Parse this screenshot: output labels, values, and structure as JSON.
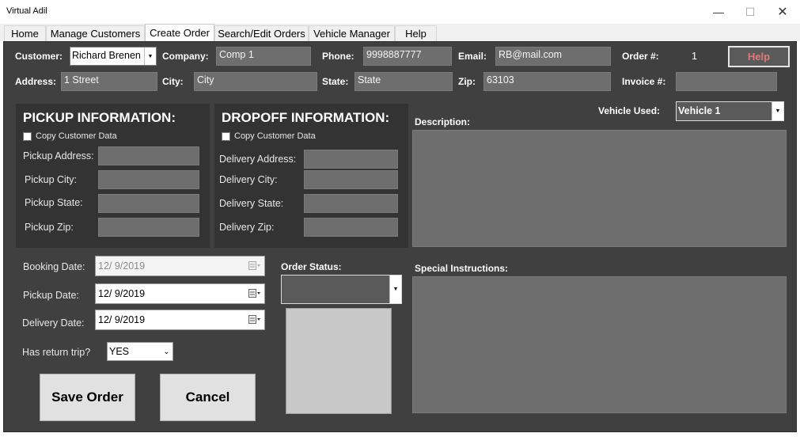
{
  "window": {
    "title": "Virtual Adil",
    "minimize": "—",
    "maximize": "☐",
    "close": "✕"
  },
  "tabs": [
    "Home",
    "Manage Customers",
    "Create Order",
    "Search/Edit Orders",
    "Vehicle Manager",
    "Help"
  ],
  "active_tab": "Create Order",
  "header": {
    "customer_label": "Customer:",
    "customer_value": "Richard Brenen",
    "company_label": "Company:",
    "company_value": "Comp 1",
    "phone_label": "Phone:",
    "phone_value": "9998887777",
    "email_label": "Email:",
    "email_value": "RB@mail.com",
    "order_label": "Order #:",
    "order_value": "1",
    "help_label": "Help",
    "address_label": "Address:",
    "address_value": "1 Street",
    "city_label": "City:",
    "city_value": "City",
    "state_label": "State:",
    "state_value": "State",
    "zip_label": "Zip:",
    "zip_value": "63103",
    "invoice_label": "Invoice #:",
    "invoice_value": ""
  },
  "pickup": {
    "heading": "PICKUP INFORMATION:",
    "copy_label": "Copy Customer Data",
    "address_label": "Pickup Address:",
    "city_label": "Pickup City:",
    "state_label": "Pickup State:",
    "zip_label": "Pickup Zip:"
  },
  "dropoff": {
    "heading": "DROPOFF INFORMATION:",
    "copy_label": "Copy Customer Data",
    "address_label": "Delivery Address:",
    "city_label": "Delivery City:",
    "state_label": "Delivery State:",
    "zip_label": "Delivery Zip:"
  },
  "vehicle": {
    "label": "Vehicle Used:",
    "value": "Vehicle 1"
  },
  "description_label": "Description:",
  "special_label": "Special Instructions:",
  "dates": {
    "booking_label": "Booking Date:",
    "booking_value": "12/  9/2019",
    "pickup_label": "Pickup Date:",
    "pickup_value": "12/  9/2019",
    "delivery_label": "Delivery Date:",
    "delivery_value": "12/  9/2019"
  },
  "return_trip": {
    "label": "Has return trip?",
    "value": "YES"
  },
  "order_status_label": "Order Status:",
  "buttons": {
    "save": "Save Order",
    "cancel": "Cancel"
  }
}
